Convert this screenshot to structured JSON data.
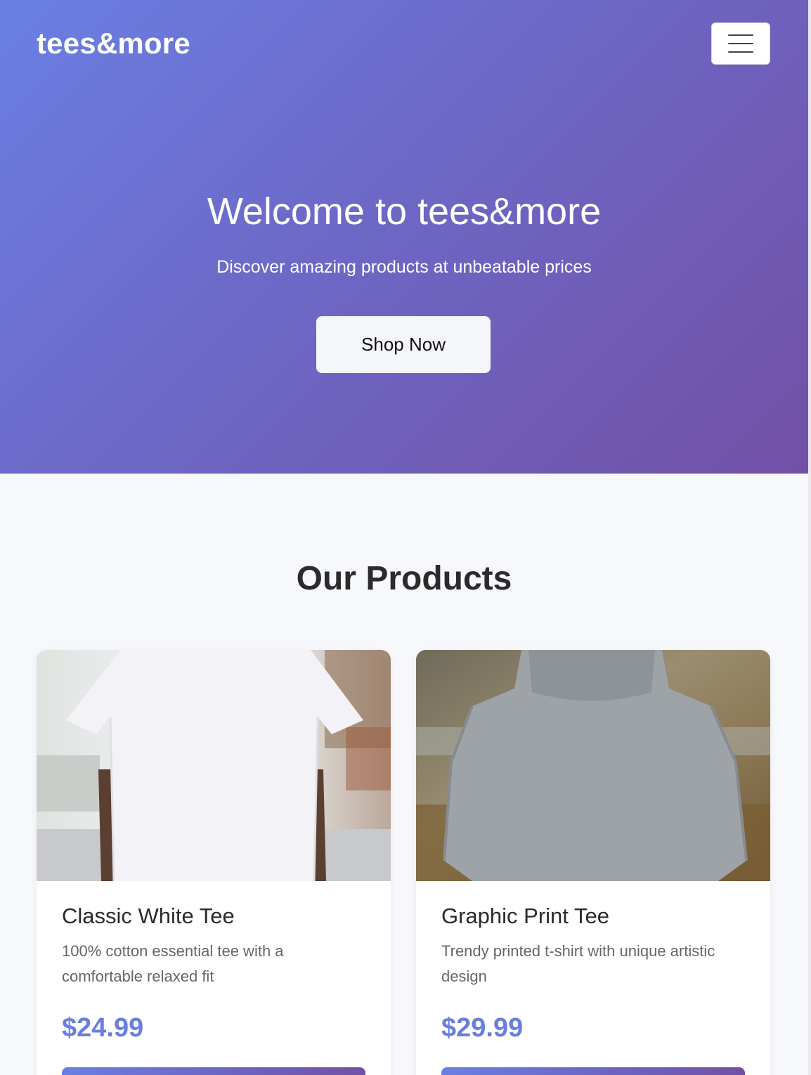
{
  "brand": {
    "name": "tees&more"
  },
  "nav": {
    "menu_icon": "hamburger-menu-icon"
  },
  "hero": {
    "title": "Welcome to tees&more",
    "subtitle": "Discover amazing products at unbeatable prices",
    "cta_label": "Shop Now",
    "gradient_start": "#6a7fe3",
    "gradient_end": "#7250a6"
  },
  "products_section": {
    "title": "Our Products",
    "items": [
      {
        "name": "Classic White Tee",
        "description": "100% cotton essential tee with a comfortable relaxed fit",
        "price": "$24.99",
        "image": "white-tshirt-photo"
      },
      {
        "name": "Graphic Print Tee",
        "description": "Trendy printed t-shirt with unique artistic design",
        "price": "$29.99",
        "image": "grey-hoodie-photo"
      }
    ]
  },
  "colors": {
    "price": "#6a7ee0",
    "page_background": "#f7f8fb"
  }
}
